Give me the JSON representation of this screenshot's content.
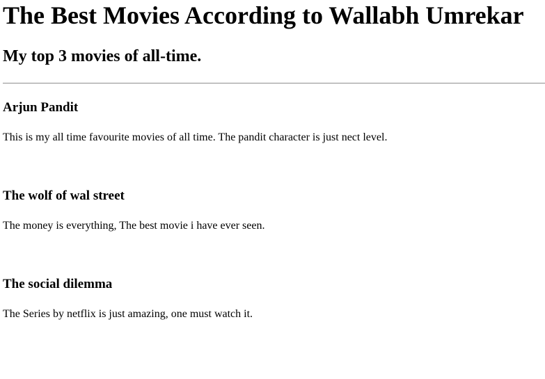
{
  "header": {
    "title": "The Best Movies According to Wallabh Umrekar",
    "subtitle": "My top 3 movies of all-time."
  },
  "movies": [
    {
      "title": "Arjun Pandit",
      "description": "This is my all time favourite movies of all time. The pandit character is just nect level."
    },
    {
      "title": "The wolf of wal street",
      "description": "The money is everything, The best movie i have ever seen."
    },
    {
      "title": "The social dilemma",
      "description": "The Series by netflix is just amazing, one must watch it."
    }
  ]
}
